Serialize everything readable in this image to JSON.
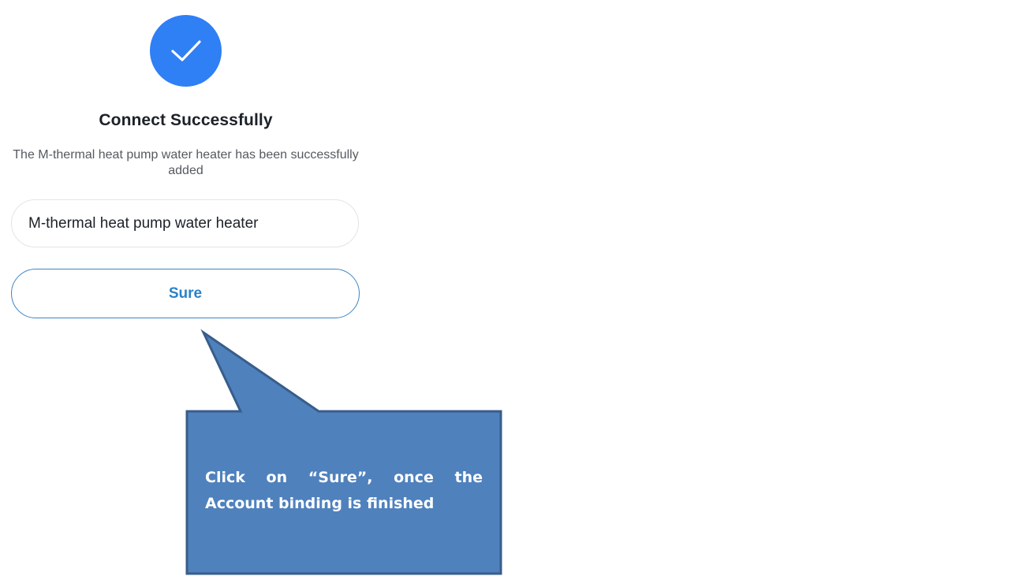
{
  "icons": {
    "success": "checkmark-circle-icon"
  },
  "colors": {
    "accent": "#2f7ff5",
    "button_text": "#2a82c8",
    "button_border": "#3d86c4",
    "callout_fill": "#4f81bd",
    "callout_border": "#385d8a",
    "callout_text": "#ffffff"
  },
  "success": {
    "title": "Connect Successfully",
    "message": "The M-thermal heat pump water heater has been successfully added"
  },
  "device_name_field": {
    "value": "M-thermal heat pump water heater"
  },
  "sure_button": {
    "label": "Sure"
  },
  "callout": {
    "text": "Click on “Sure”, once the Account binding is finished"
  }
}
